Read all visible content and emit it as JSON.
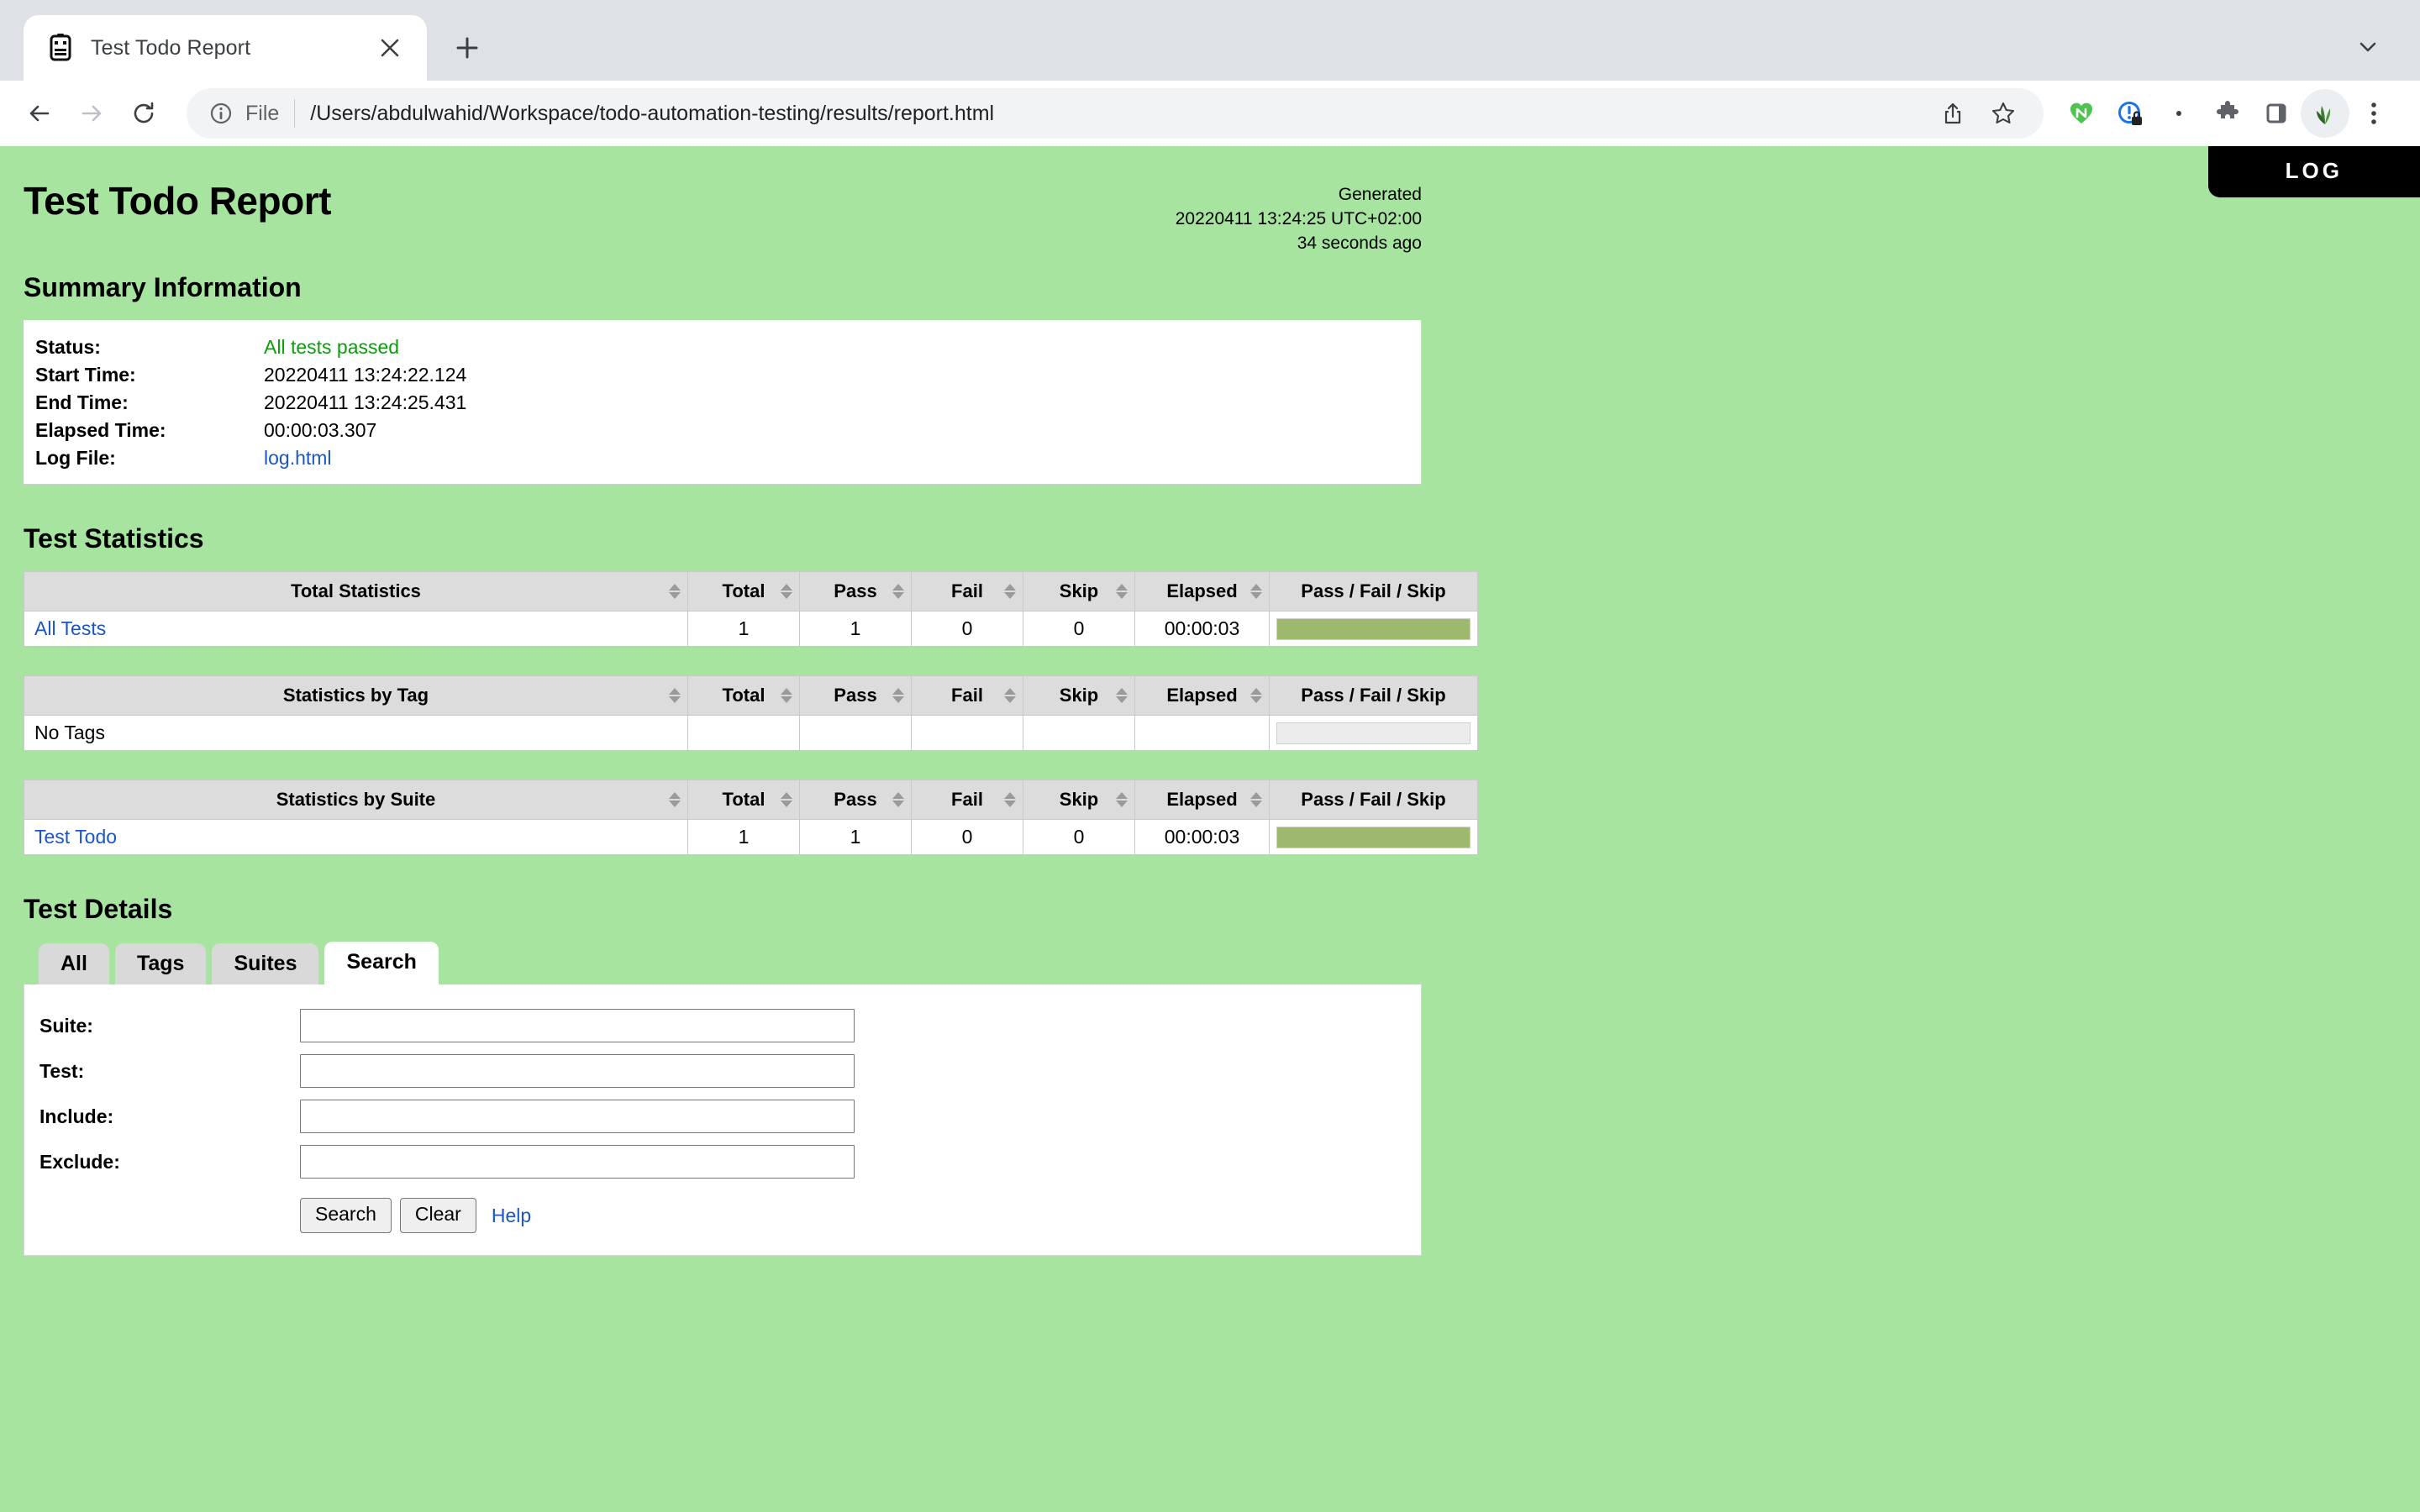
{
  "browser": {
    "tab": {
      "title": "Test Todo Report",
      "favicon_icon": "robot-favicon",
      "close_icon": "close-icon"
    },
    "new_tab_icon": "plus-icon",
    "tab_list_icon": "chevron-down-icon",
    "nav": {
      "back_icon": "back-arrow-icon",
      "forward_icon": "forward-arrow-icon",
      "reload_icon": "reload-icon"
    },
    "omnibox": {
      "info_icon": "info-circle-icon",
      "scheme_label": "File",
      "url": "/Users/abdulwahid/Workspace/todo-automation-testing/results/report.html",
      "share_icon": "share-icon",
      "bookmark_icon": "star-icon"
    },
    "extensions": [
      {
        "name": "heart-extension-icon"
      },
      {
        "name": "lock-shield-extension-icon"
      },
      {
        "name": "dot-extension-icon"
      },
      {
        "name": "puzzle-extensions-icon"
      },
      {
        "name": "side-panel-icon"
      }
    ],
    "avatar_icon": "profile-avatar-icon",
    "menu_icon": "three-dot-menu-icon"
  },
  "page": {
    "log_badge_label": "LOG",
    "title": "Test Todo Report",
    "generated": {
      "label": "Generated",
      "timestamp": "20220411 13:24:25 UTC+02:00",
      "relative": "34 seconds ago"
    },
    "summary": {
      "heading": "Summary Information",
      "rows": [
        {
          "label": "Status:",
          "value": "All tests passed",
          "kind": "status-pass"
        },
        {
          "label": "Start Time:",
          "value": "20220411 13:24:22.124",
          "kind": "text"
        },
        {
          "label": "End Time:",
          "value": "20220411 13:24:25.431",
          "kind": "text"
        },
        {
          "label": "Elapsed Time:",
          "value": "00:00:03.307",
          "kind": "text"
        },
        {
          "label": "Log File:",
          "value": "log.html",
          "kind": "link"
        }
      ]
    },
    "statistics": {
      "heading": "Test Statistics",
      "columns": [
        "Total",
        "Pass",
        "Fail",
        "Skip",
        "Elapsed",
        "Pass / Fail / Skip"
      ],
      "tables": [
        {
          "name_header": "Total Statistics",
          "rows": [
            {
              "name": "All Tests",
              "is_link": true,
              "total": "1",
              "pass": "1",
              "fail": "0",
              "skip": "0",
              "elapsed": "00:00:03",
              "bar": {
                "pass_pct": 100,
                "fail_pct": 0,
                "skip_pct": 0
              }
            }
          ]
        },
        {
          "name_header": "Statistics by Tag",
          "rows": [
            {
              "name": "No Tags",
              "is_link": false,
              "total": "",
              "pass": "",
              "fail": "",
              "skip": "",
              "elapsed": "",
              "bar": {
                "pass_pct": 0,
                "fail_pct": 0,
                "skip_pct": 0
              }
            }
          ]
        },
        {
          "name_header": "Statistics by Suite",
          "rows": [
            {
              "name": "Test Todo",
              "is_link": true,
              "total": "1",
              "pass": "1",
              "fail": "0",
              "skip": "0",
              "elapsed": "00:00:03",
              "bar": {
                "pass_pct": 100,
                "fail_pct": 0,
                "skip_pct": 0
              }
            }
          ]
        }
      ]
    },
    "details": {
      "heading": "Test Details",
      "tabs": [
        {
          "label": "All",
          "active": false
        },
        {
          "label": "Tags",
          "active": false
        },
        {
          "label": "Suites",
          "active": false
        },
        {
          "label": "Search",
          "active": true
        }
      ],
      "search_form": {
        "fields": [
          {
            "label": "Suite:",
            "value": "",
            "placeholder": ""
          },
          {
            "label": "Test:",
            "value": "",
            "placeholder": ""
          },
          {
            "label": "Include:",
            "value": "",
            "placeholder": ""
          },
          {
            "label": "Exclude:",
            "value": "",
            "placeholder": ""
          }
        ],
        "search_button": "Search",
        "clear_button": "Clear",
        "help_link": "Help"
      }
    }
  },
  "colors": {
    "page_background": "#a6e4a0",
    "pass_bar": "#9eb96d",
    "empty_bar": "#ececec",
    "status_pass_text": "#0b9d0b",
    "link": "#1a56c4",
    "table_header": "#dcdcdc"
  }
}
